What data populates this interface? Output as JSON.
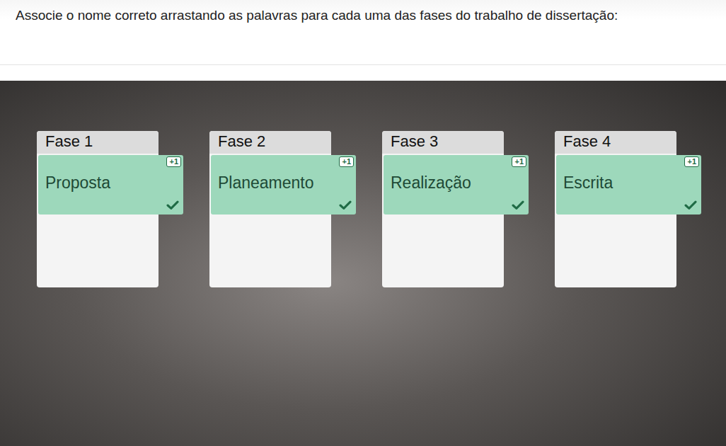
{
  "question": "Associe o nome correto arrastando as palavras para cada uma das fases do trabalho de dissertação:",
  "phases": [
    {
      "label": "Fase 1",
      "answer": "Proposta",
      "points": "+1",
      "correct": true
    },
    {
      "label": "Fase 2",
      "answer": "Planeamento",
      "points": "+1",
      "correct": true
    },
    {
      "label": "Fase 3",
      "answer": "Realização",
      "points": "+1",
      "correct": true
    },
    {
      "label": "Fase 4",
      "answer": "Escrita",
      "points": "+1",
      "correct": true
    }
  ]
}
